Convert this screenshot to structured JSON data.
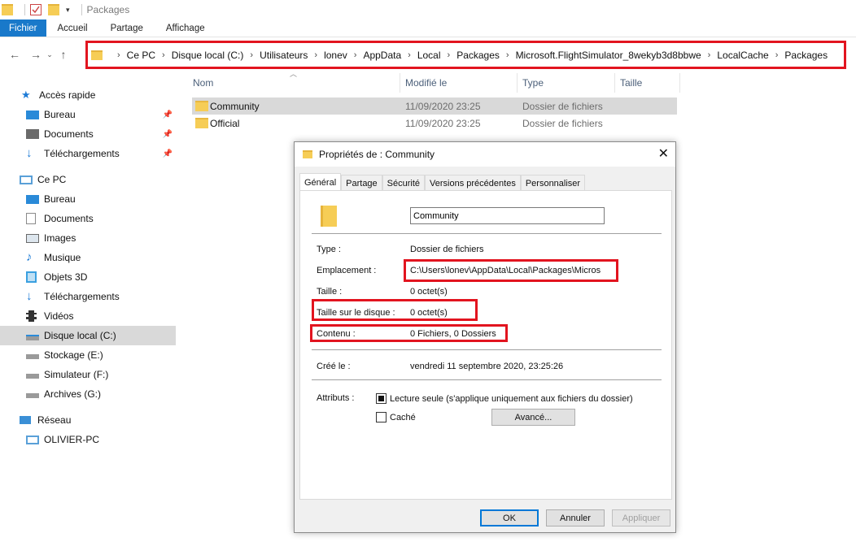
{
  "window": {
    "title": "Packages"
  },
  "ribbon": {
    "tabs": [
      "Fichier",
      "Accueil",
      "Partage",
      "Affichage"
    ]
  },
  "address": {
    "crumbs": [
      "Ce PC",
      "Disque local (C:)",
      "Utilisateurs",
      "lonev",
      "AppData",
      "Local",
      "Packages",
      "Microsoft.FlightSimulator_8wekyb3d8bbwe",
      "LocalCache",
      "Packages"
    ]
  },
  "sidebar": {
    "items": [
      {
        "label": "Accès rapide",
        "icon": "star-icon"
      },
      {
        "label": "Bureau",
        "icon": "desktop-icon",
        "pinned": true
      },
      {
        "label": "Documents",
        "icon": "documents-icon",
        "pinned": true
      },
      {
        "label": "Téléchargements",
        "icon": "download-icon",
        "pinned": true
      },
      {
        "label": "Ce PC",
        "icon": "computer-icon"
      },
      {
        "label": "Bureau",
        "icon": "desktop-icon"
      },
      {
        "label": "Documents",
        "icon": "documents-icon"
      },
      {
        "label": "Images",
        "icon": "images-icon"
      },
      {
        "label": "Musique",
        "icon": "music-icon"
      },
      {
        "label": "Objets 3D",
        "icon": "3d-objects-icon"
      },
      {
        "label": "Téléchargements",
        "icon": "download-icon"
      },
      {
        "label": "Vidéos",
        "icon": "videos-icon"
      },
      {
        "label": "Disque local (C:)",
        "icon": "drive-icon",
        "selected": true
      },
      {
        "label": "Stockage (E:)",
        "icon": "drive-icon"
      },
      {
        "label": "Simulateur (F:)",
        "icon": "drive-icon"
      },
      {
        "label": "Archives (G:)",
        "icon": "drive-icon"
      },
      {
        "label": "Réseau",
        "icon": "network-icon"
      },
      {
        "label": "OLIVIER-PC",
        "icon": "computer-icon"
      }
    ]
  },
  "filelist": {
    "columns": [
      "Nom",
      "Modifié le",
      "Type",
      "Taille"
    ],
    "rows": [
      {
        "name": "Community",
        "modified": "11/09/2020 23:25",
        "type": "Dossier de fichiers",
        "selected": true
      },
      {
        "name": "Official",
        "modified": "11/09/2020 23:25",
        "type": "Dossier de fichiers"
      }
    ]
  },
  "dialog": {
    "title": "Propriétés de : Community",
    "tabs": [
      "Général",
      "Partage",
      "Sécurité",
      "Versions précédentes",
      "Personnaliser"
    ],
    "name_value": "Community",
    "type_label": "Type :",
    "type_value": "Dossier de fichiers",
    "location_label": "Emplacement :",
    "location_value": "C:\\Users\\lonev\\AppData\\Local\\Packages\\Micros",
    "size_label": "Taille :",
    "size_value": "0 octet(s)",
    "disk_size_label": "Taille sur le disque :",
    "disk_size_value": "0 octet(s)",
    "contents_label": "Contenu :",
    "contents_value": "0 Fichiers, 0 Dossiers",
    "created_label": "Créé le :",
    "created_value": "vendredi 11 septembre 2020, 23:25:26",
    "attributes_label": "Attributs :",
    "readonly_label": "Lecture seule (s'applique uniquement aux fichiers du dossier)",
    "hidden_label": "Caché",
    "advanced_button": "Avancé...",
    "ok_button": "OK",
    "cancel_button": "Annuler",
    "apply_button": "Appliquer"
  },
  "colors": {
    "highlight_red": "#e2141f",
    "file_tab_blue": "#1979ca",
    "folder_yellow": "#f6cd56"
  }
}
